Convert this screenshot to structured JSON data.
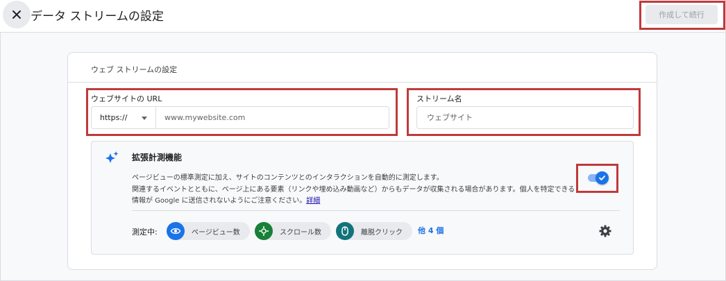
{
  "header": {
    "title": "データ ストリームの設定",
    "create_button": "作成して続行"
  },
  "card": {
    "title": "ウェブ ストリームの設定"
  },
  "url_field": {
    "label": "ウェブサイトの URL",
    "protocol": "https://",
    "placeholder": "www.mywebsite.com"
  },
  "stream_name": {
    "label": "ストリーム名",
    "placeholder": "ウェブサイト"
  },
  "enhanced": {
    "title": "拡張計測機能",
    "desc_line1": "ページビューの標準測定に加え、サイトのコンテンツとのインタラクションを自動的に測定します。",
    "desc_line2": "関連するイベントとともに、ページ上にある要素（リンクや埋め込み動画など）からもデータが収集される場合があります。個人を特定できる",
    "desc_line3": "情報が Google に送信されないようにご注意ください。",
    "detail_link": "詳細",
    "toggle_on": true,
    "measuring_label": "測定中:",
    "chips": [
      {
        "label": "ページビュー数",
        "icon": "eye-icon",
        "color": "#1a73e8"
      },
      {
        "label": "スクロール数",
        "icon": "crosshair-icon",
        "color": "#188038"
      },
      {
        "label": "離脱クリック",
        "icon": "mouse-icon",
        "color": "#12737b"
      }
    ],
    "more_link": "他 4 個"
  },
  "colors": {
    "highlight": "#c0393b",
    "accent": "#1a73e8"
  }
}
